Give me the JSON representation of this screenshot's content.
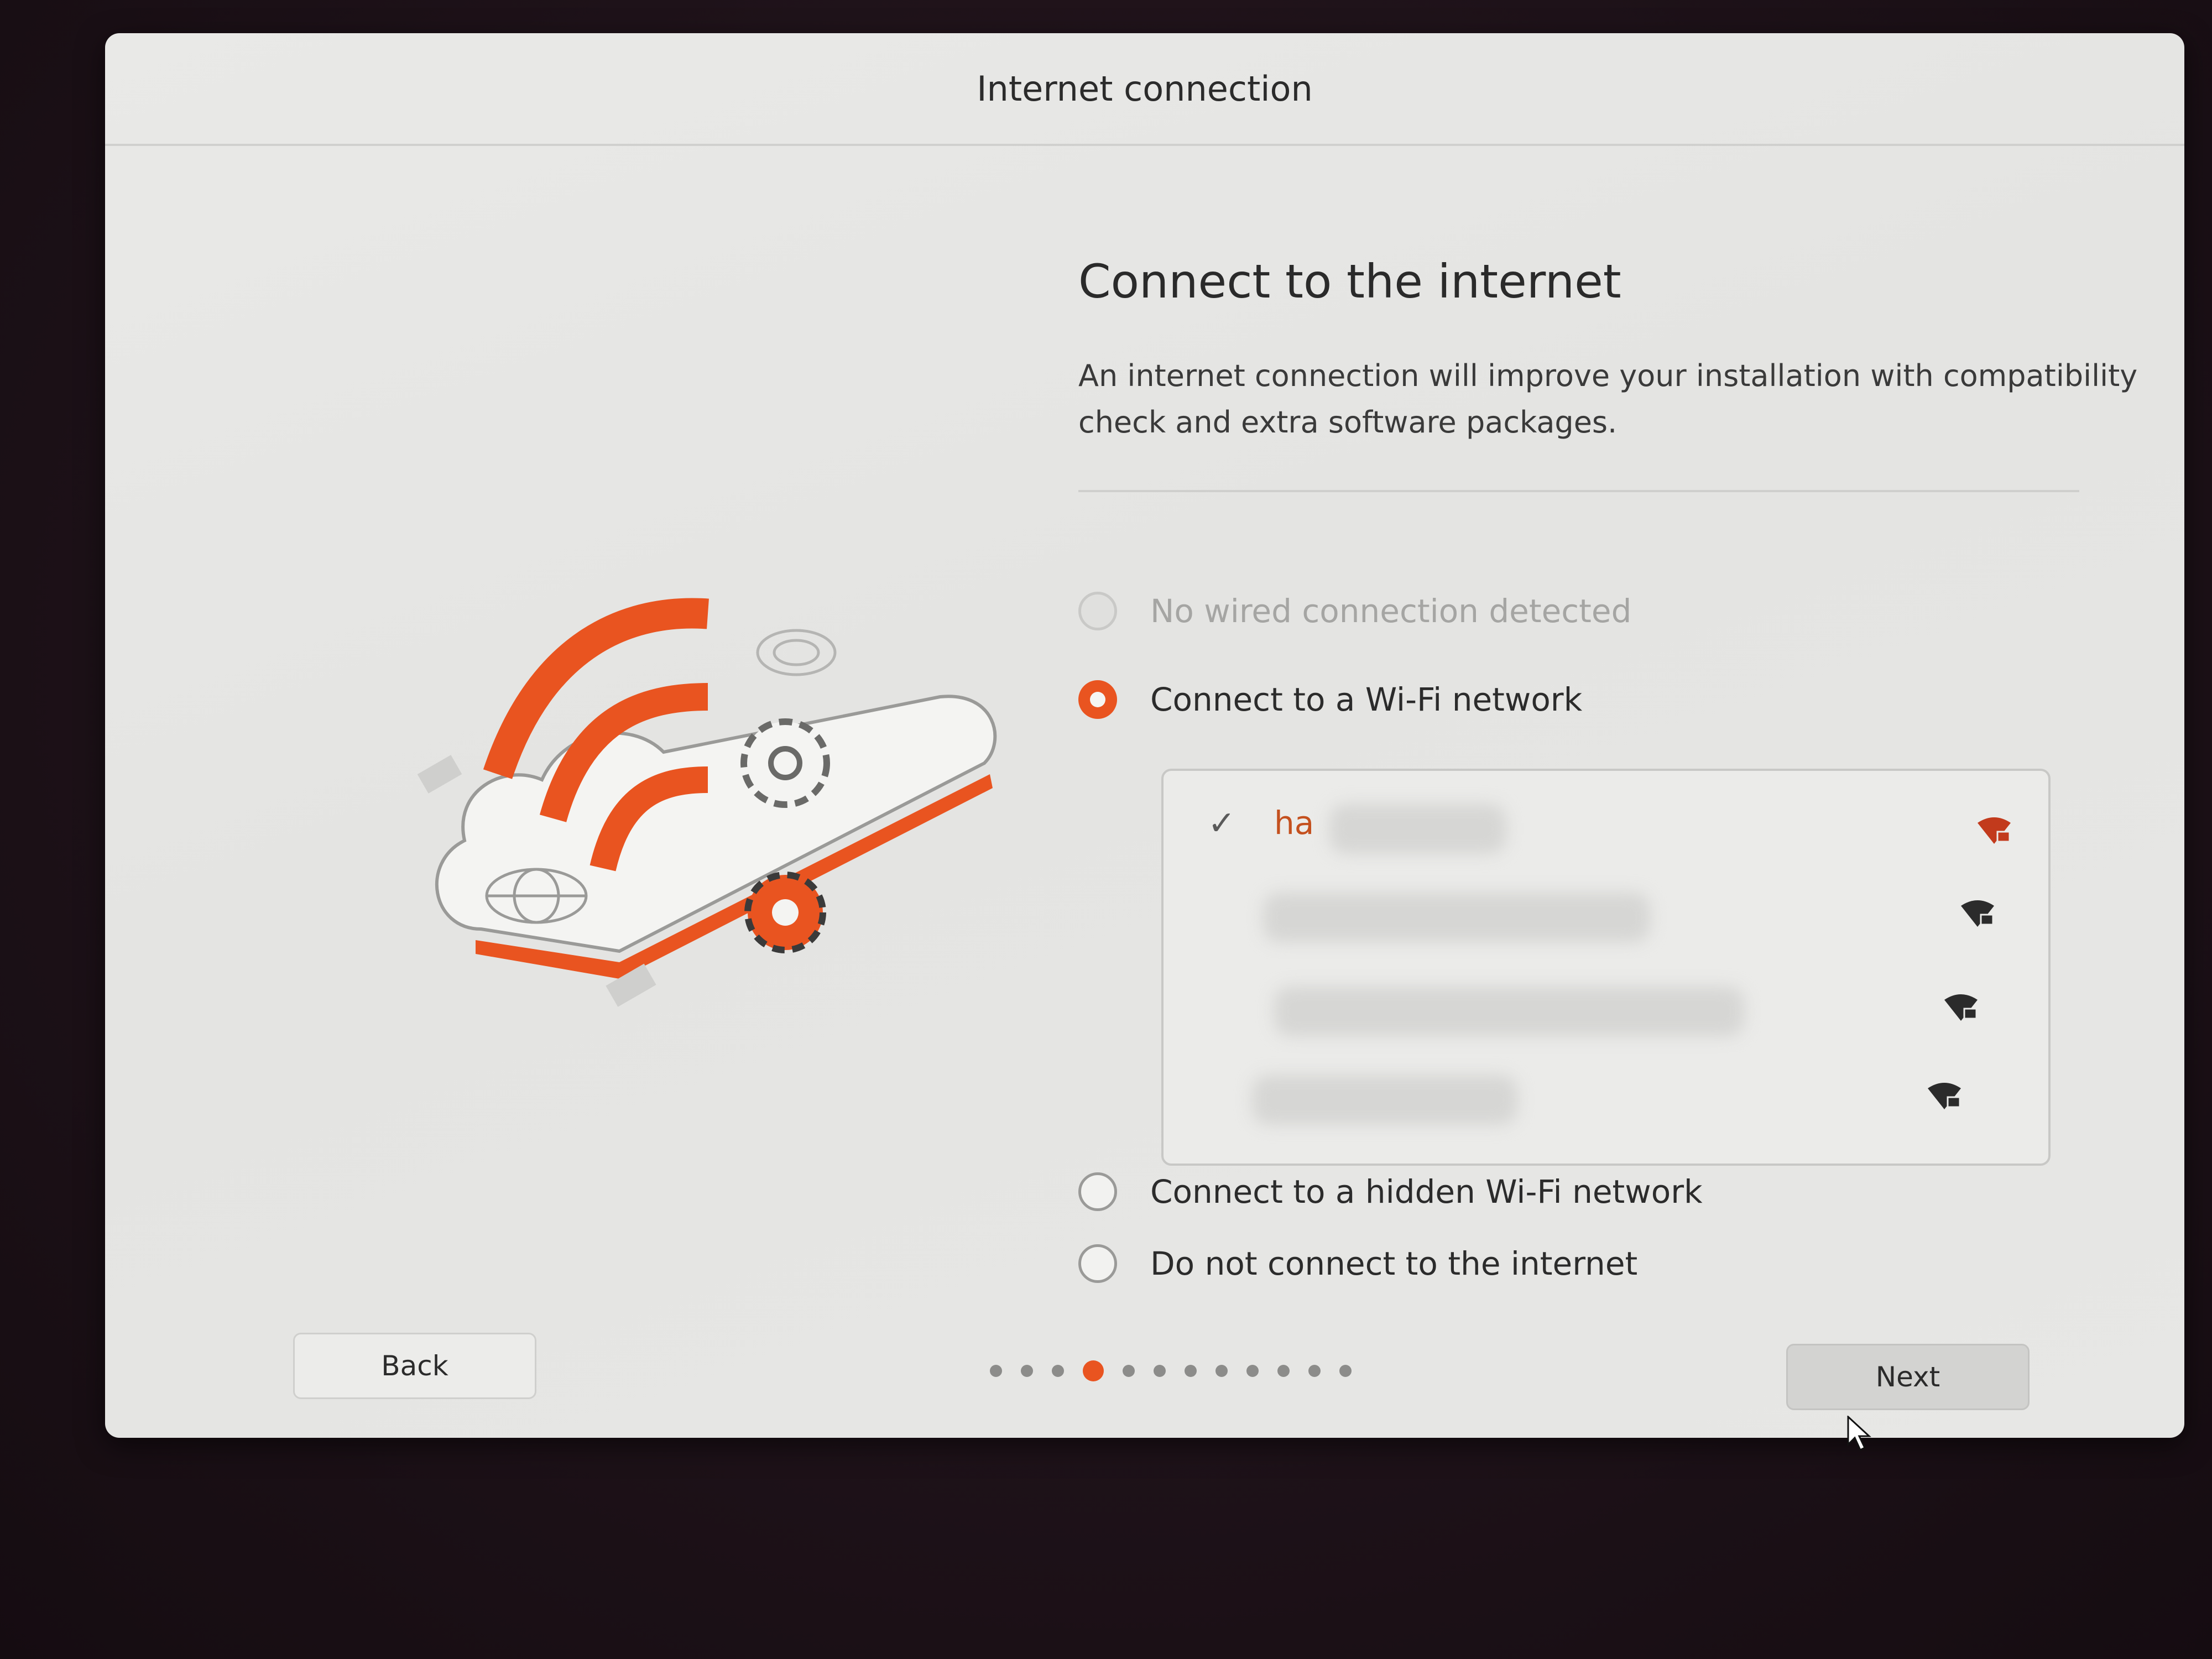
{
  "window": {
    "title": "Internet connection"
  },
  "page": {
    "title": "Connect to the internet",
    "description": "An internet connection will improve your installation with compatibility check and extra software packages."
  },
  "options": {
    "wired": {
      "label": "No wired connection detected",
      "selected": false,
      "disabled": true
    },
    "wifi": {
      "label": "Connect to a Wi-Fi network",
      "selected": true
    },
    "hidden": {
      "label": "Connect to a hidden Wi-Fi network",
      "selected": false
    },
    "none": {
      "label": "Do not connect to the internet",
      "selected": false
    }
  },
  "wifi_networks": [
    {
      "ssid": "ha",
      "connected": true,
      "secured": true,
      "icon": "wifi-lock-icon"
    },
    {
      "ssid": "",
      "connected": false,
      "secured": true,
      "icon": "wifi-lock-icon"
    },
    {
      "ssid": "",
      "connected": false,
      "secured": true,
      "icon": "wifi-lock-icon"
    },
    {
      "ssid": "",
      "connected": false,
      "secured": true,
      "icon": "wifi-lock-icon"
    }
  ],
  "navigation": {
    "back_label": "Back",
    "next_label": "Next",
    "total_steps": 12,
    "current_step": 4
  },
  "colors": {
    "accent": "#e95420",
    "window_bg": "#e6e6e4",
    "text": "#2b2b2b",
    "disabled_text": "#a5a5a3"
  },
  "icons": {
    "checkmark": "check-icon",
    "signal": "wifi-lock-icon",
    "illustration": "cloud-wifi-illustration"
  }
}
